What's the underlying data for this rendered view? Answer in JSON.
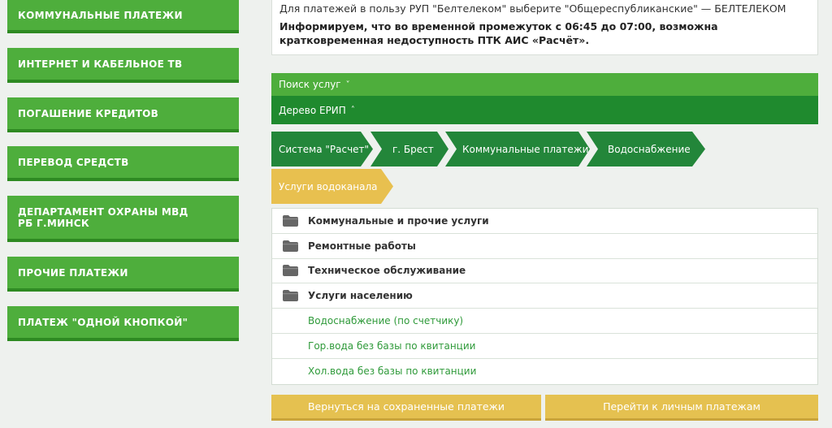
{
  "sidebar": {
    "items": [
      {
        "label": "КОММУНАЛЬНЫЕ ПЛАТЕЖИ"
      },
      {
        "label": "ИНТЕРНЕТ И КАБЕЛЬНОЕ ТВ"
      },
      {
        "label": "ПОГАШЕНИЕ КРЕДИТОВ"
      },
      {
        "label": "ПЕРЕВОД СРЕДСТВ"
      },
      {
        "label": "ДЕПАРТАМЕНТ ОХРАНЫ МВД РБ Г.МИНСК"
      },
      {
        "label": "ПРОЧИЕ ПЛАТЕЖИ"
      },
      {
        "label": "ПЛАТЕЖ \"ОДНОЙ КНОПКОЙ\""
      }
    ]
  },
  "notice": {
    "line1": "Для платежей в пользу РУП \"Белтелеком\" выберите \"Общереспубликанские\" — БЕЛТЕЛЕКОМ",
    "bold": "Информируем, что во временной промежуток с 06:45 до 07:00, возможна кратковременная недоступность ПТК АИС «Расчёт»."
  },
  "search_bar": {
    "label": "Поиск услуг",
    "chevron": "˅"
  },
  "tree_bar": {
    "label": "Дерево ЕРИП",
    "chevron": "˄"
  },
  "breadcrumbs": [
    {
      "label": "Система \"Расчет\""
    },
    {
      "label": "г. Брест"
    },
    {
      "label": "Коммунальные платежи"
    },
    {
      "label": "Водоснабжение"
    }
  ],
  "current_crumb": {
    "label": "Услуги водоканала"
  },
  "folders": [
    {
      "label": "Коммунальные и прочие услуги",
      "icon": "folder-icon"
    },
    {
      "label": "Ремонтные работы",
      "icon": "folder-icon"
    },
    {
      "label": "Техническое обслуживание",
      "icon": "folder-icon"
    },
    {
      "label": "Услуги населению",
      "icon": "folder-icon"
    }
  ],
  "services": [
    {
      "label": "Водоснабжение (по счетчику)"
    },
    {
      "label": "Гор.вода без базы по квитанции"
    },
    {
      "label": "Хол.вода без базы по квитанции"
    }
  ],
  "buttons": {
    "back": "Вернуться на сохраненные платежи",
    "personal": "Перейти к личным платежам"
  },
  "colors": {
    "menu_green": "#4eae3c",
    "dark_green": "#1f8a2e",
    "breadcrumb_green": "#23863a",
    "accent_yellow": "#e8c04f",
    "link_green": "#2f9a3a"
  }
}
